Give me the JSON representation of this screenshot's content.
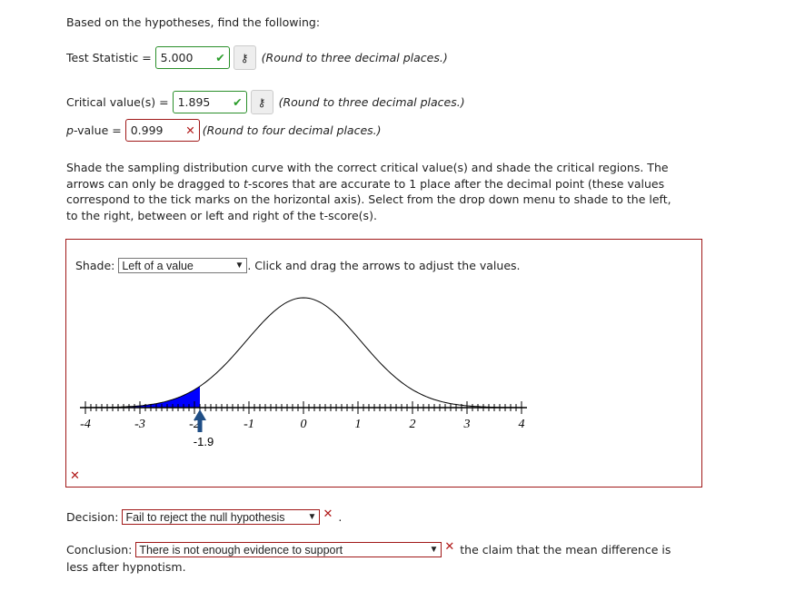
{
  "intro": "Based on the hypotheses, find the following:",
  "test_statistic": {
    "label": "Test Statistic =",
    "value": "5.000",
    "status": "correct",
    "hint": "(Round to three decimal places.)"
  },
  "critical_value": {
    "label": "Critical value(s) =",
    "value": "1.895",
    "status": "correct",
    "hint": "(Round to three decimal places.)"
  },
  "p_value": {
    "label_italic": "p",
    "label": "-value =",
    "value": "0.999",
    "status": "incorrect",
    "hint": "(Round to four decimal places.)"
  },
  "instructions": {
    "line1": "Shade the sampling distribution curve with the correct critical value(s) and shade the critical regions. The",
    "line2a": "arrows can only be dragged to ",
    "line2t": "t",
    "line2b": "-scores that are accurate to 1 place after the decimal point (these values",
    "line3": "correspond to the tick marks on the horizontal axis). Select from the drop down menu to shade to the left,",
    "line4": "to the right, between or left and right of the t-score(s)."
  },
  "graph": {
    "shade_label": "Shade:",
    "shade_selected": "Left of a value",
    "drag_hint": ". Click and drag the arrows to adjust the values.",
    "tick_labels": [
      "-4",
      "-3",
      "-2",
      "-1",
      "0",
      "1",
      "2",
      "3",
      "4"
    ],
    "arrow_value": "-1.9",
    "arrow_t": -1.9,
    "shade_color": "#0000ff",
    "status": "incorrect"
  },
  "decision": {
    "label": "Decision:",
    "selected": "Fail to reject the null hypothesis",
    "status": "incorrect",
    "trailing": "."
  },
  "conclusion": {
    "label": "Conclusion:",
    "selected": "There is not enough evidence to support",
    "status": "incorrect",
    "tail1": "the claim that the mean difference is",
    "tail2": "less after hypnotism."
  }
}
